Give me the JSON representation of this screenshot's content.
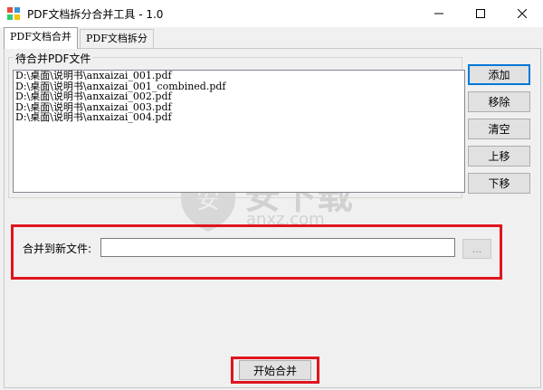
{
  "window": {
    "title": "PDF文档拆分合并工具 - 1.0",
    "minimize_glyph": "—",
    "maximize_glyph": "☐",
    "close_glyph": "✕"
  },
  "tabs": [
    {
      "label": "PDF文档合并",
      "active": true
    },
    {
      "label": "PDF文档拆分",
      "active": false
    }
  ],
  "merge": {
    "group_label": "待合并PDF文件",
    "files": [
      "D:\\桌面\\说明书\\anxaizai_001.pdf",
      "D:\\桌面\\说明书\\anxaizai_001_combined.pdf",
      "D:\\桌面\\说明书\\anxaizai_002.pdf",
      "D:\\桌面\\说明书\\anxaizai_003.pdf",
      "D:\\桌面\\说明书\\anxaizai_004.pdf"
    ],
    "buttons": {
      "add": "添加",
      "remove": "移除",
      "clear": "清空",
      "move_up": "上移",
      "move_down": "下移"
    },
    "output_label": "合并到新文件:",
    "output_value": "",
    "browse_label": "...",
    "start_label": "开始合并"
  },
  "watermark": {
    "text": "安下载",
    "subtext": "anxz.com"
  },
  "colors": {
    "highlight": "#e0151f",
    "accent": "#0078d7"
  }
}
